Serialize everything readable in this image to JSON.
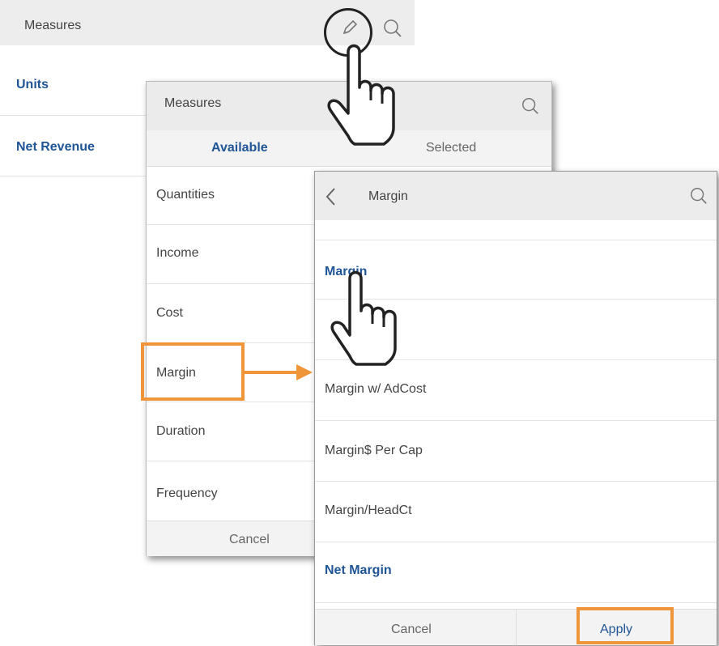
{
  "back_panel": {
    "title": "Measures",
    "items": [
      "Units",
      "Net Revenue"
    ]
  },
  "mid_panel": {
    "title": "Measures",
    "tabs": {
      "available": "Available",
      "selected": "Selected"
    },
    "items": [
      "Quantities",
      "Income",
      "Cost",
      "Margin",
      "Duration",
      "Frequency"
    ],
    "cancel_label": "Cancel"
  },
  "front_panel": {
    "title": "Margin",
    "items": [
      "Margin",
      "Margin w/ AdCost",
      "Margin$ Per Cap",
      "Margin/HeadCt",
      "Net Margin"
    ],
    "cancel_label": "Cancel",
    "apply_label": "Apply"
  },
  "icons": {
    "edit": "pencil-icon",
    "search": "search-icon",
    "back": "chevron-left-icon",
    "pointer": "hand-pointer-icon"
  },
  "colors": {
    "accent_blue": "#1f5596",
    "callout_orange": "#f0963a",
    "header_gray": "#ebebeb"
  }
}
